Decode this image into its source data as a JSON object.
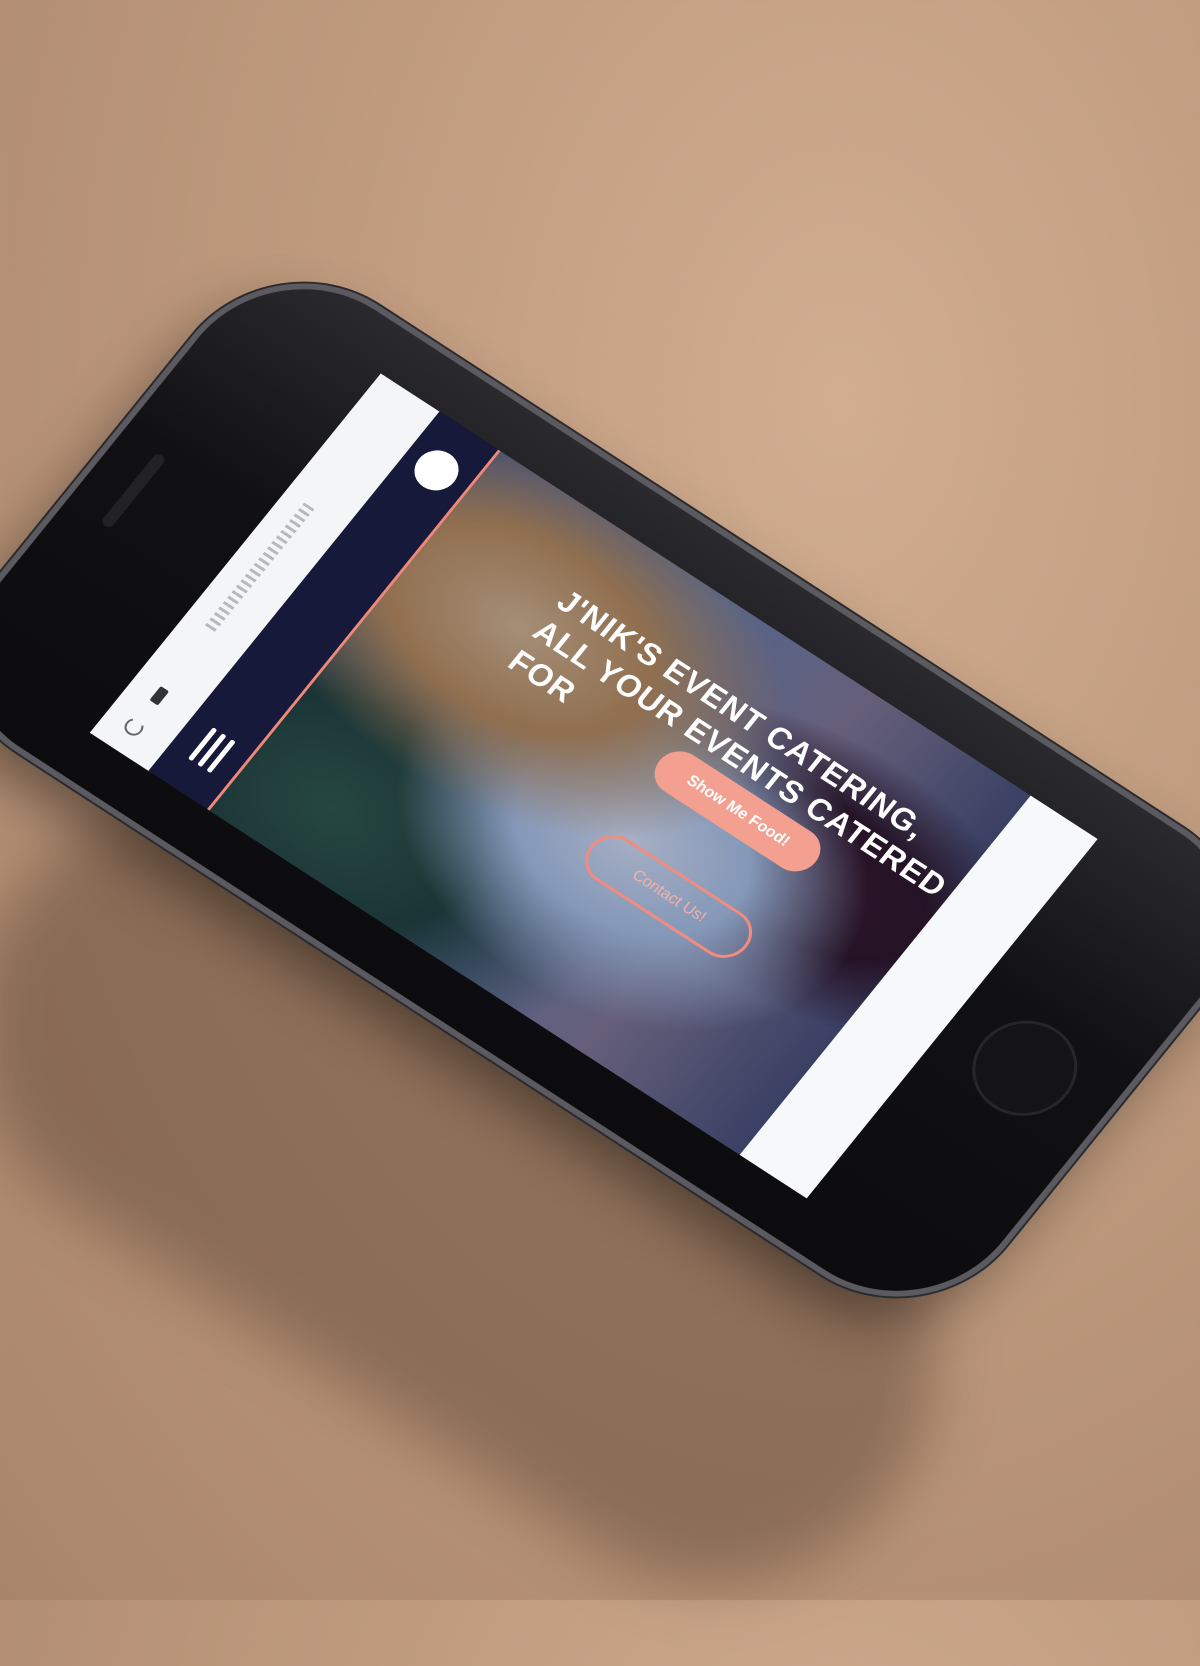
{
  "hero": {
    "headline_lines": [
      "J'NIK'S EVENT CATERING,",
      "ALL YOUR EVENTS CATERED",
      "FOR"
    ],
    "primary_button": "Show Me Food!",
    "secondary_button": "Contact Us!"
  },
  "icons": {
    "logo": "logo-circle-icon",
    "menu": "hamburger-menu-icon",
    "reload": "reload-icon",
    "battery": "battery-icon"
  },
  "colors": {
    "nav_background": "#16193a",
    "accent": "#f08878",
    "primary_button": "#f4a090"
  }
}
